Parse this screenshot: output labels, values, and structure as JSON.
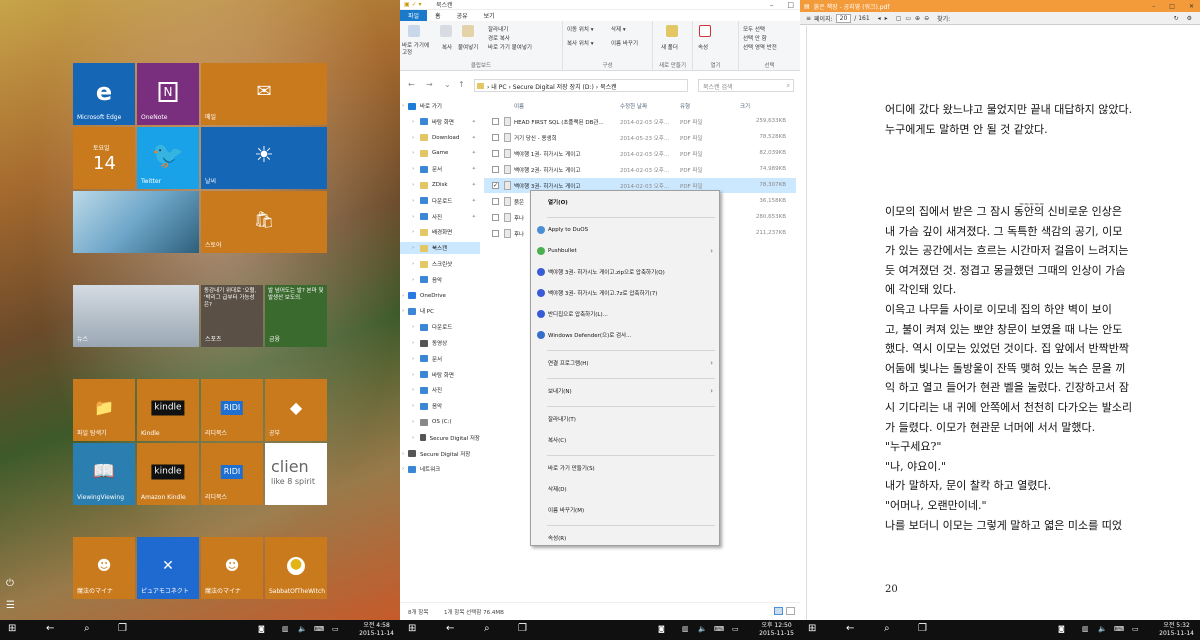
{
  "start": {
    "tiles": {
      "edge": "Microsoft Edge",
      "onenote": "OneNote",
      "mail": "메일",
      "cal_day": "토요일",
      "cal_date": "14",
      "twitter": "Twitter",
      "weather": "날씨",
      "store": "스토어",
      "news": "뉴스",
      "news_headline": "동강내기 위대로 '오혈, '박리그 급부터 가능성은?",
      "sports": "스포츠",
      "sports_headline": "발 넘어도는 발? 본마 및 발생산 보도의.",
      "finance": "금융",
      "explorer": "파일 탐색기",
      "kindle": "Kindle",
      "ridi1": "리디북스",
      "gongbu": "공부",
      "viewing": "ViewingViewing",
      "amazon_kindle": "Amazon Kindle",
      "ridi2": "리디북스",
      "clien_line1": "clien",
      "clien_line2": "like 8 spirit",
      "anime1": "魔法のマイナ",
      "puyo": "ピュアモコネクト",
      "anime2": "魔法のマイナ",
      "sabbat": "SabbatOfTheWitch"
    }
  },
  "explorer": {
    "title": "북스캔",
    "tabs": [
      "파일",
      "홈",
      "공유",
      "보기"
    ],
    "ribbon": {
      "pin": "바로 가기에 고정",
      "copy": "복사",
      "paste": "붙여넣기",
      "cut": "잘라내기",
      "copy_path": "경로 복사",
      "paste_shortcut": "바로 가기 붙여넣기",
      "clipboard": "클립보드",
      "move_to": "이동 위치 ▾",
      "copy_to": "복사 위치 ▾",
      "delete": "삭제 ▾",
      "rename": "이름 바꾸기",
      "organize": "구성",
      "new_folder": "새 폴더",
      "new": "새로 만들기",
      "properties": "속성",
      "open": "열기",
      "select_all": "모두 선택",
      "select_none": "선택 안 함",
      "invert": "선택 영역 반전",
      "select": "선택"
    },
    "address": {
      "path": "›  내 PC  ›  Secure Digital 저장 장치 (D:)  ›  북스캔",
      "search_placeholder": "북스캔 검색"
    },
    "nav": [
      {
        "label": "바로 가기",
        "level": 0
      },
      {
        "label": "바탕 화면",
        "level": 1,
        "pin": true
      },
      {
        "label": "Download",
        "level": 1,
        "pin": true
      },
      {
        "label": "Game",
        "level": 1,
        "pin": true
      },
      {
        "label": "문서",
        "level": 1,
        "pin": true
      },
      {
        "label": "ZDisk",
        "level": 1,
        "pin": true
      },
      {
        "label": "다운로드",
        "level": 1,
        "pin": true
      },
      {
        "label": "사진",
        "level": 1,
        "pin": true
      },
      {
        "label": "배경화면",
        "level": 1
      },
      {
        "label": "북스캔",
        "level": 1,
        "selected": true
      },
      {
        "label": "스크린샷",
        "level": 1
      },
      {
        "label": "음악",
        "level": 1
      },
      {
        "label": "OneDrive",
        "level": 0
      },
      {
        "label": "내 PC",
        "level": 0
      },
      {
        "label": "다운로드",
        "level": 1
      },
      {
        "label": "동영상",
        "level": 1
      },
      {
        "label": "문서",
        "level": 1
      },
      {
        "label": "바탕 화면",
        "level": 1
      },
      {
        "label": "사진",
        "level": 1
      },
      {
        "label": "음악",
        "level": 1
      },
      {
        "label": "OS (C:)",
        "level": 1
      },
      {
        "label": "Secure Digital 저장",
        "level": 1
      },
      {
        "label": "Secure Digital 저장",
        "level": 0
      },
      {
        "label": "네트워크",
        "level": 0
      }
    ],
    "columns": {
      "name": "이름",
      "date": "수정한 날짜",
      "type": "유형",
      "size": "크기"
    },
    "files": [
      {
        "name": "HEAD FIRST SQL (초플랙된 DB관...",
        "date": "2014-02-03 오후...",
        "type": "PDF 파일",
        "size": "259,633KB"
      },
      {
        "name": "거기 당신 - 용생희",
        "date": "2014-05-23 오후...",
        "type": "PDF 파일",
        "size": "78,528KB"
      },
      {
        "name": "백야행 1권- 히가시노 게이고",
        "date": "2014-02-03 오후...",
        "type": "PDF 파일",
        "size": "82,039KB"
      },
      {
        "name": "백야행 2권- 히가시노 게이고",
        "date": "2014-02-03 오후...",
        "type": "PDF 파일",
        "size": "74,989KB"
      },
      {
        "name": "백야행 3권- 히가시노 게이고",
        "date": "2014-02-03 오후...",
        "type": "PDF 파일",
        "size": "78,307KB",
        "selected": true
      },
      {
        "name": "붉은",
        "date": "",
        "type": "",
        "size": "36,158KB"
      },
      {
        "name": "후나",
        "date": "",
        "type": "",
        "size": "280,653KB"
      },
      {
        "name": "후나",
        "date": "",
        "type": "",
        "size": "211,237KB"
      }
    ],
    "status": {
      "count": "8개 항목",
      "selected": "1개 항목 선택함 76.4MB"
    },
    "context_menu": {
      "items": [
        {
          "label": "열기(O)",
          "bold": true
        },
        {
          "label": "Apply to DuOS",
          "icon": "#4a8fd6"
        },
        {
          "label": "Pushbullet",
          "icon": "#4caf50",
          "arrow": true
        },
        {
          "label": "백야행 3권- 히가시노 게이고.zip으로 압축하기(Q)",
          "icon": "#3a5bd6"
        },
        {
          "label": "백야행 3권- 히가시노 게이고.7z로 압축하기(7)",
          "icon": "#3a5bd6"
        },
        {
          "label": "반디집으로 압축하기(L)...",
          "icon": "#3a5bd6"
        },
        {
          "label": "Windows Defender(으)로 검사...",
          "icon": "#3470c9"
        },
        {
          "label": "연결 프로그램(H)",
          "arrow": true
        },
        {
          "label": "보내기(N)",
          "arrow": true
        },
        {
          "label": "잘라내기(T)"
        },
        {
          "label": "복사(C)"
        },
        {
          "label": "바로 가기 만들기(S)"
        },
        {
          "label": "삭제(D)"
        },
        {
          "label": "이름 바꾸기(M)"
        },
        {
          "label": "속성(R)"
        }
      ]
    }
  },
  "reader": {
    "title": "붉은 책장 - 공지영 (워크).pdf",
    "toolbar": {
      "page_label": "페이지:",
      "page_current": "20",
      "page_total": "/ 161",
      "find_label": "찾기:"
    },
    "lines_top": [
      "어디에 갔다 왔느냐고 물었지만 끝내 대답하지 않았다.",
      "누구에게도 말하면 안 될 것 같았다."
    ],
    "ornament": "≈≈≈≈≈",
    "lines_body": [
      "이모의 집에서 받은 그 잠시 동안의 신비로운 인상은",
      "내 가슴 깊이 새겨졌다. 그 독특한 색감의 공기, 이모",
      "가 있는 공간에서는 흐르는 시간마저 걸음이 느려지는",
      "듯 여겨졌던 것. 정겹고 몽글했던 그때의 인상이 가슴",
      "에 각인돼 있다.",
      "이윽고 나무들 사이로 이모네 집의 하얀 벽이 보이",
      "고, 불이 켜져 있는 뽀얀 창문이 보였을 때 나는 안도",
      "했다. 역시 이모는 있었던 것이다. 집 앞에서 반짝반짝",
      "어둠에 빛나는 돌방울이 잔뜩 맺혀 있는 녹슨 문을 끼",
      "익 하고 열고 들어가 현관 벨을 눌렀다. 긴장하고서 잠",
      "시 기다리는 내 귀에 안쪽에서 천천히 다가오는 발소리",
      "가 들렸다. 이모가 현관문 너머에 서서 말했다.",
      "\"누구세요?\"",
      "\"나, 야요이.\"",
      "내가 말하자, 문이 찰칵 하고 열렸다.",
      "\"어머나, 오랜만이네.\"",
      "나를 보더니 이모는 그렇게 말하고 엷은 미소를 띠었"
    ],
    "page_number": "20"
  },
  "taskbars": [
    {
      "time": "오전 4:58",
      "date": "2015-11-14"
    },
    {
      "time": "오후 12:50",
      "date": "2015-11-15"
    },
    {
      "time": "오전 5:32",
      "date": "2015-11-14"
    }
  ]
}
